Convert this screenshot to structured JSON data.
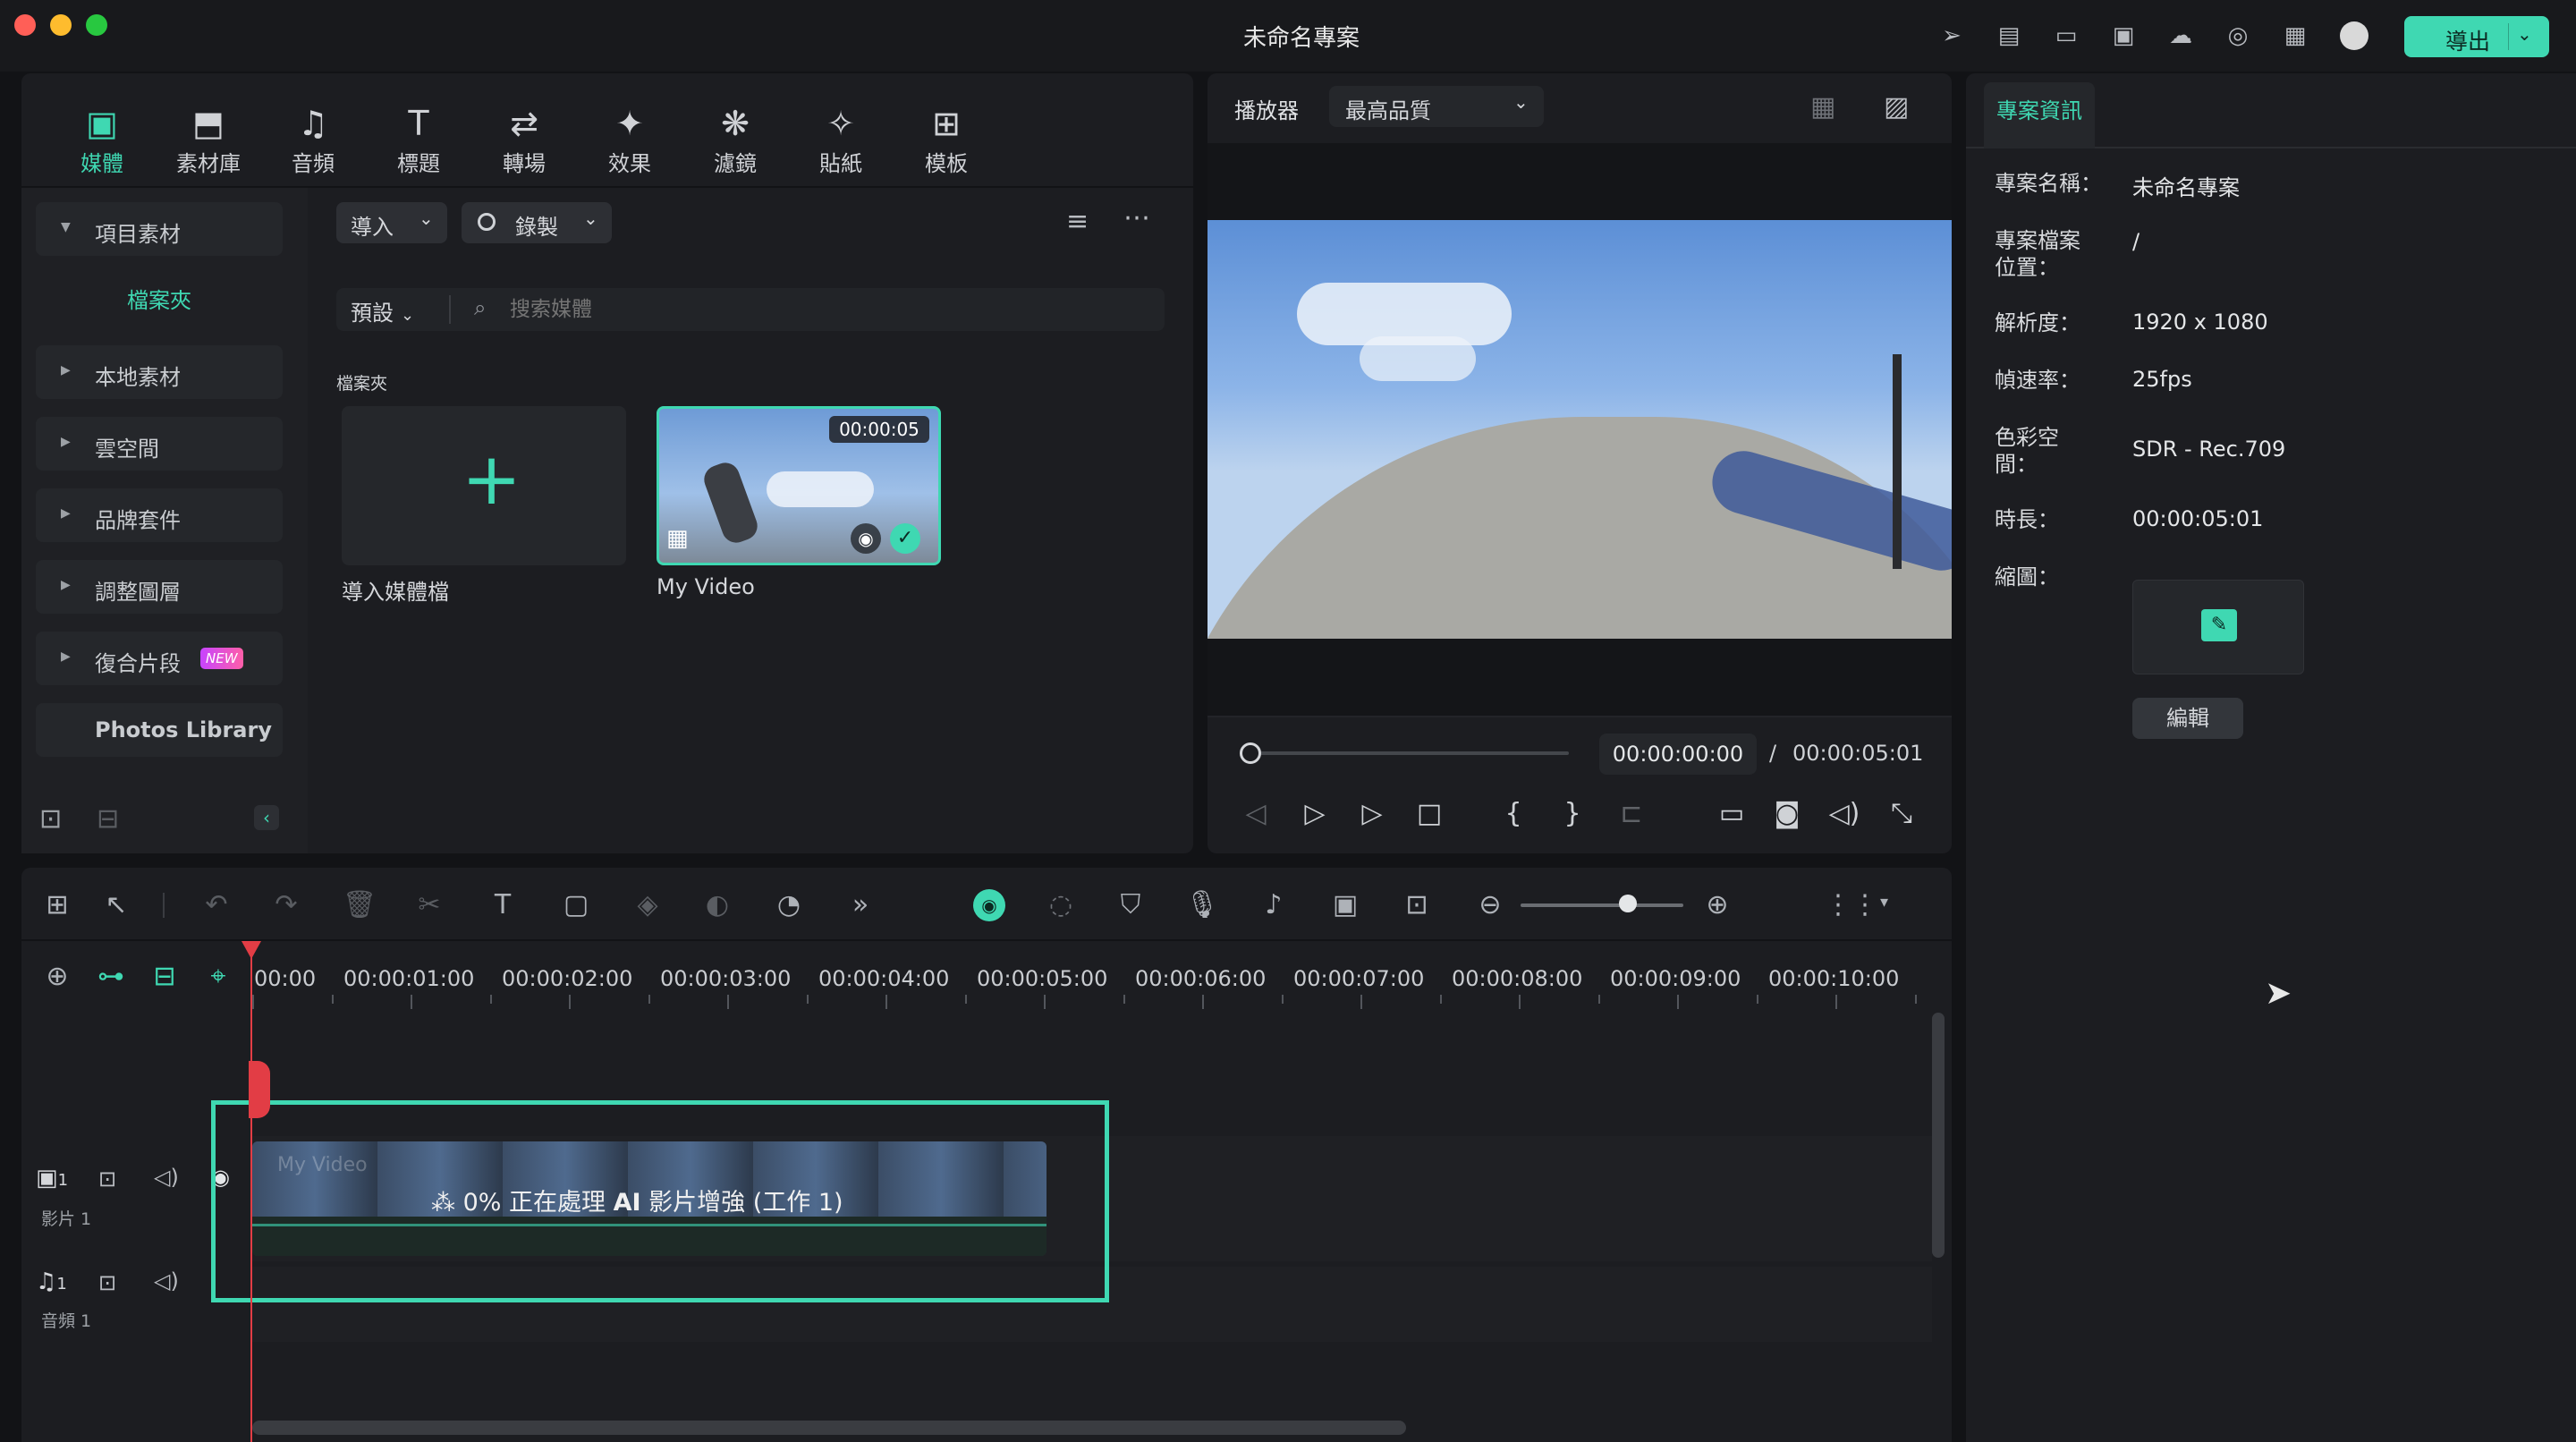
{
  "window": {
    "title": "未命名專案",
    "export_label": "導出"
  },
  "media_tabs": [
    {
      "label": "媒體",
      "icon": "media-icon",
      "active": true
    },
    {
      "label": "素材庫",
      "icon": "stock-library-icon"
    },
    {
      "label": "音頻",
      "icon": "music-note-icon"
    },
    {
      "label": "標題",
      "icon": "title-T-icon"
    },
    {
      "label": "轉場",
      "icon": "transition-icon"
    },
    {
      "label": "效果",
      "icon": "effects-sparkle-icon"
    },
    {
      "label": "濾鏡",
      "icon": "filters-icon"
    },
    {
      "label": "貼紙",
      "icon": "sticker-icon"
    },
    {
      "label": "模板",
      "icon": "template-icon"
    }
  ],
  "sidebar": {
    "items": [
      {
        "label": "項目素材"
      },
      {
        "label": "檔案夾"
      },
      {
        "label": "本地素材"
      },
      {
        "label": "雲空間"
      },
      {
        "label": "品牌套件"
      },
      {
        "label": "調整圖層"
      },
      {
        "label": "復合片段",
        "badge": "NEW"
      },
      {
        "label": "Photos Library"
      }
    ]
  },
  "media": {
    "import_label": "導入",
    "record_label": "錄製",
    "preset_label": "預設",
    "search_placeholder": "搜索媒體",
    "folder_heading": "檔案夾",
    "import_tile_label": "導入媒體檔",
    "clip": {
      "name": "My Video",
      "duration": "00:00:05"
    }
  },
  "player": {
    "label": "播放器",
    "quality": "最高品質",
    "current_time": "00:00:00:00",
    "separator": "/",
    "total_time": "00:00:05:01"
  },
  "timeline": {
    "ruler": [
      "00:00",
      "00:00:01:00",
      "00:00:02:00",
      "00:00:03:00",
      "00:00:04:00",
      "00:00:05:00",
      "00:00:06:00",
      "00:00:07:00",
      "00:00:08:00",
      "00:00:09:00",
      "00:00:10:00"
    ],
    "video_track_label": "影片 1",
    "video_track_num": "1",
    "audio_track_label": "音頻 1",
    "audio_track_num": "1",
    "clip_ghost_name": "My Video",
    "processing_text_pre": "0% 正在處理 ",
    "processing_text_ai": "AI",
    "processing_text_post": " 影片增強 (工作 1)"
  },
  "info_panel": {
    "tab_label": "專案資訊",
    "rows": [
      {
        "label": "專案名稱：",
        "value": "未命名專案"
      },
      {
        "label": "專案檔案\n位置：",
        "value": "/"
      },
      {
        "label": "解析度：",
        "value": "1920 x 1080"
      },
      {
        "label": "幀速率：",
        "value": "25fps"
      },
      {
        "label": "色彩空\n間：",
        "value": "SDR - Rec.709"
      },
      {
        "label": "時長：",
        "value": "00:00:05:01"
      },
      {
        "label": "縮圖：",
        "value": ""
      }
    ],
    "edit_label": "編輯"
  },
  "colors": {
    "accent": "#3fd8b2",
    "playhead": "#e23d45",
    "background": "#121316",
    "panel": "#1c1d21"
  }
}
